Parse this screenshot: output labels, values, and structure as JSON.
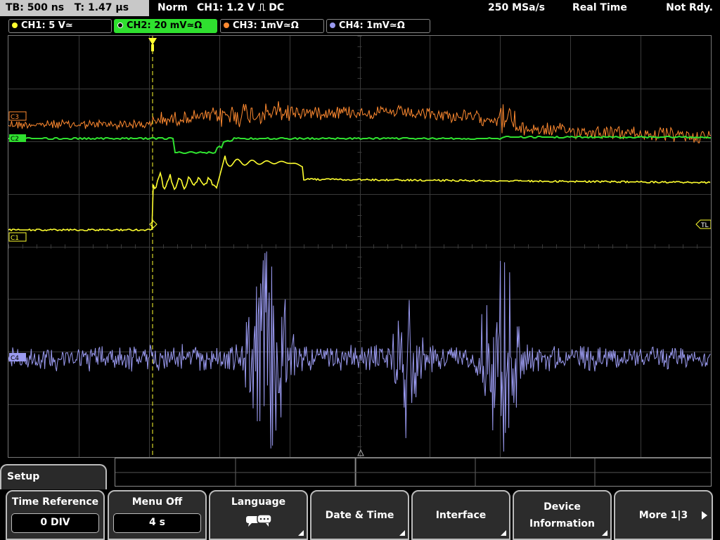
{
  "header": {
    "timebase": "TB: 500 ns   T: 1.47 µs",
    "trigger_mode": "Norm",
    "trigger_info": "CH1: 1.2 V ⎍ DC",
    "sample_rate": "250 MSa/s",
    "acq_mode": "Real Time",
    "status": "Not Rdy."
  },
  "channels": [
    {
      "label": "CH1: 5 V≃",
      "color": "#ffff30"
    },
    {
      "label": "CH2: 20 mV≃Ω",
      "color": "#2fe02f"
    },
    {
      "label": "CH3: 1mV≃Ω",
      "color": "#ff8a30"
    },
    {
      "label": "CH4: 1mV≃Ω",
      "color": "#9a9af0"
    }
  ],
  "markers": {
    "ch3": "C3",
    "ch2": "C2",
    "ch1": "C1",
    "ch4": "C4",
    "trigger_level": "TL"
  },
  "menu": {
    "title": "Setup",
    "softkeys": [
      {
        "label": "Time Reference",
        "value": "0 DIV"
      },
      {
        "label": "Menu Off",
        "value": "4 s"
      },
      {
        "label": "Language",
        "value": ""
      },
      {
        "label": "Date & Time",
        "value": ""
      },
      {
        "label": "Interface",
        "value": ""
      },
      {
        "label": "Device Information",
        "value": ""
      },
      {
        "label": "More 1|3",
        "value": ""
      }
    ]
  },
  "colors": {
    "grid": "#3a3a3a",
    "trigger_line": "#ffff30"
  }
}
